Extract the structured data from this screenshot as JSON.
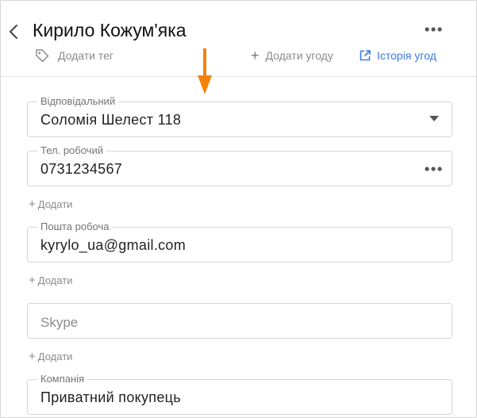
{
  "header": {
    "title": "Кирило Кожум'яка",
    "add_tag_label": "Додати тег",
    "add_deal_label": "Додати угоду",
    "deal_history_label": "Історія угод",
    "accent_color": "#3d7be0"
  },
  "annotation": {
    "arrow_color": "#f5820d"
  },
  "fields": {
    "responsible": {
      "label": "Відповідальний",
      "value": "Соломія Шелест 118"
    },
    "work_phone": {
      "label": "Тел. робочий",
      "value": "0731234567"
    },
    "work_email": {
      "label": "Пошта робоча",
      "value": "kyrylo_ua@gmail.com"
    },
    "skype": {
      "placeholder": "Skype"
    },
    "company": {
      "label": "Компанія",
      "value": "Приватний покупець"
    }
  },
  "add_link_label": "Додати"
}
